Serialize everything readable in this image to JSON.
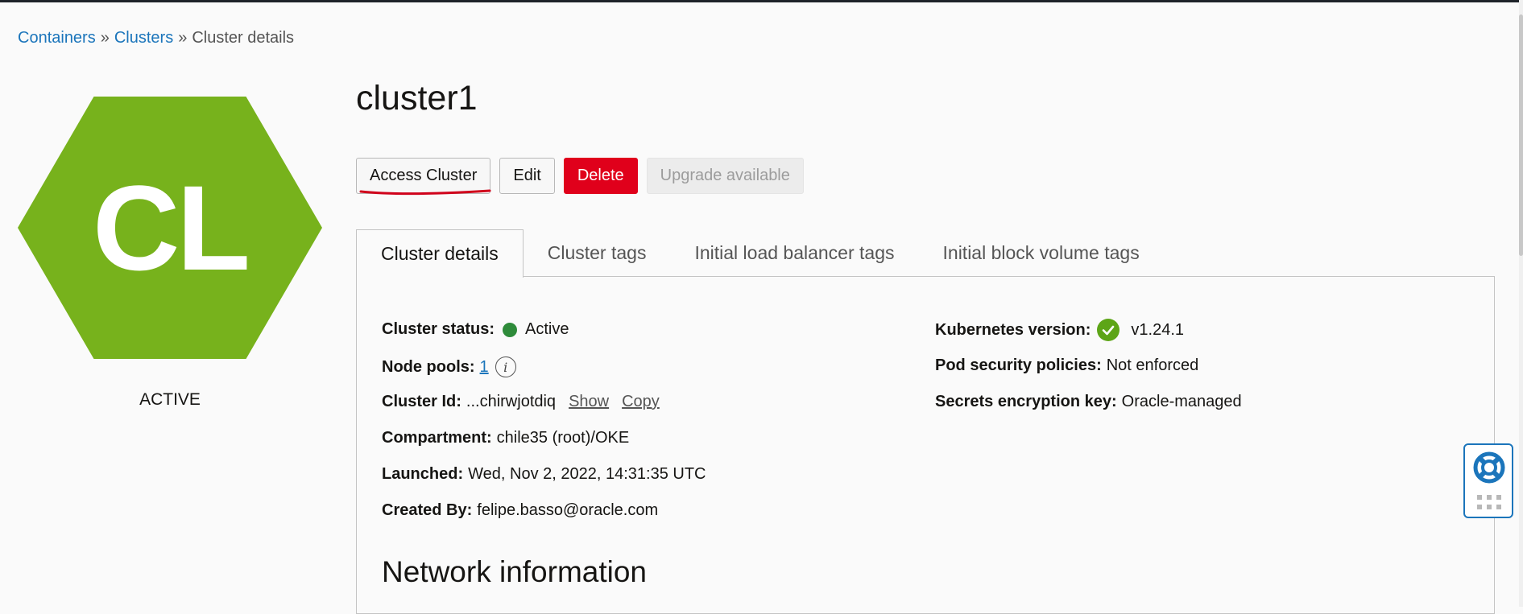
{
  "breadcrumb": {
    "items": [
      "Containers",
      "Clusters",
      "Cluster details"
    ],
    "separator": "»"
  },
  "resource_badge": {
    "initials": "CL",
    "color": "#77b21c",
    "lifecycle_state": "ACTIVE"
  },
  "page_title": "cluster1",
  "actions": {
    "access_cluster": "Access Cluster",
    "edit": "Edit",
    "delete": "Delete",
    "upgrade": "Upgrade available"
  },
  "tabs": [
    {
      "label": "Cluster details",
      "active": true
    },
    {
      "label": "Cluster tags",
      "active": false
    },
    {
      "label": "Initial load balancer tags",
      "active": false
    },
    {
      "label": "Initial block volume tags",
      "active": false
    }
  ],
  "details": {
    "cluster_status": {
      "label": "Cluster status:",
      "value": "Active"
    },
    "node_pools": {
      "label": "Node pools:",
      "value": "1"
    },
    "cluster_id": {
      "label": "Cluster Id:",
      "value": "...chirwjotdiq",
      "show": "Show",
      "copy": "Copy"
    },
    "compartment": {
      "label": "Compartment:",
      "value": "chile35 (root)/OKE"
    },
    "launched": {
      "label": "Launched:",
      "value": "Wed, Nov 2, 2022, 14:31:35 UTC"
    },
    "created_by": {
      "label": "Created By:",
      "value": "felipe.basso@oracle.com"
    },
    "kubernetes_version": {
      "label": "Kubernetes version:",
      "value": "v1.24.1"
    },
    "pod_security": {
      "label": "Pod security policies:",
      "value": "Not enforced"
    },
    "secrets_key": {
      "label": "Secrets encryption key:",
      "value": "Oracle-managed"
    }
  },
  "network_section_title": "Network information",
  "colors": {
    "link": "#1b75bb",
    "danger": "#e0001b",
    "status_active": "#2e8b3a",
    "annotation": "#d0021b"
  },
  "icons": {
    "status": "status-dot-icon",
    "info": "info-icon",
    "version_ok": "check-circle-icon",
    "help": "lifebuoy-icon",
    "apps": "grid-icon"
  }
}
